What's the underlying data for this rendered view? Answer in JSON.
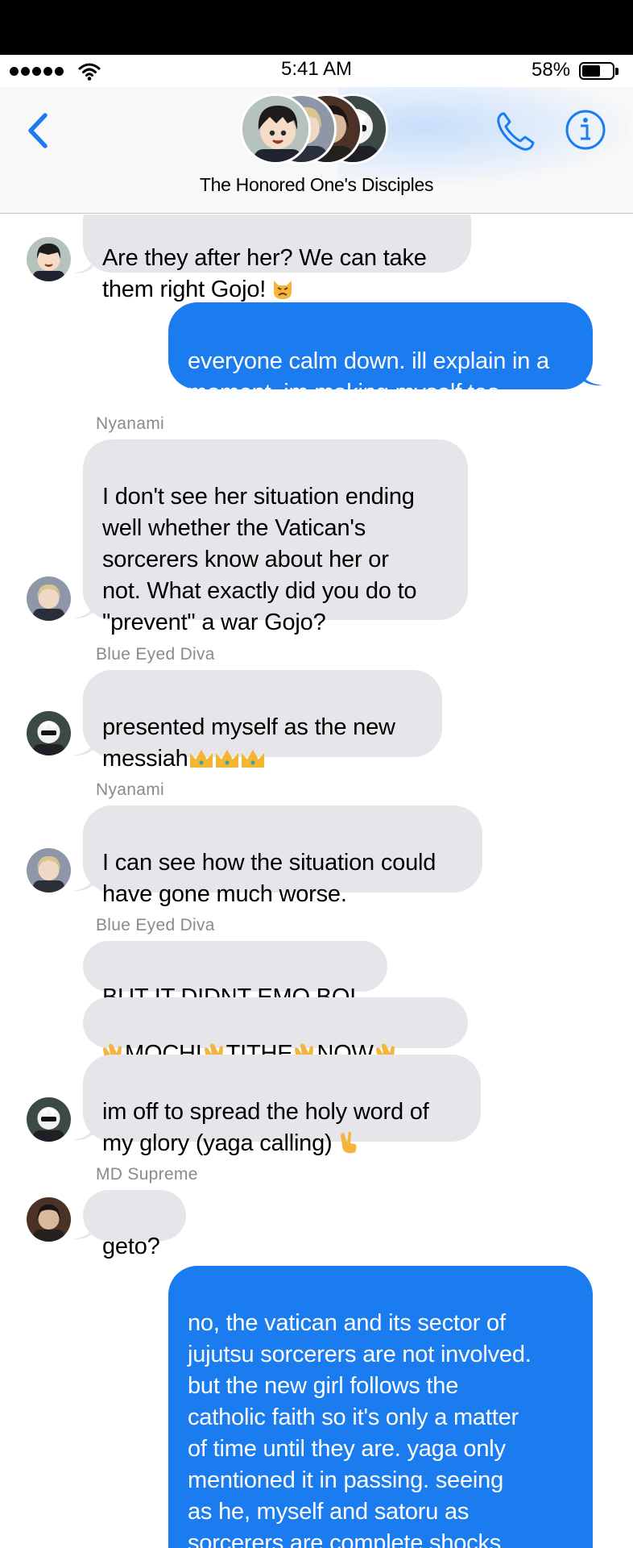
{
  "status_bar": {
    "time": "5:41 AM",
    "battery_percent": "58%",
    "battery_level": 0.58,
    "signal_bars": 5
  },
  "header": {
    "group_name": "The Honored One's Disciples",
    "back_icon": "chevron-left-icon",
    "call_icon": "phone-icon",
    "info_icon": "info-icon",
    "accent_color": "#1b7cf0"
  },
  "senders": {
    "nyanami": "Nyanami",
    "diva_1": "Blue Eyed Diva",
    "nyanami_2": "Nyanami",
    "diva_2": "Blue Eyed Diva",
    "md": "MD Supreme"
  },
  "messages": {
    "m1": "Are they after her? We can take\nthem right Gojo!",
    "m2": "everyone calm down. ill explain in a\nmoment. im making myself tea",
    "m3": "I don't see her situation ending\nwell whether the Vatican's\nsorcerers know about her or\nnot. What exactly did you do to\n\"prevent\" a war Gojo?",
    "m4": "presented myself as the new\nmessiah",
    "m5": "I can see how the situation could\nhave gone much worse.",
    "m6": "BUT IT DIDNT EMO BOI",
    "m7_1": "MOCHI",
    "m7_2": "TITHE",
    "m7_3": "NOW",
    "m8": "im off to spread the holy word of\nmy glory (yaga calling)",
    "m9": "geto?",
    "m10": "no, the vatican and its sector of\njujutsu sorcerers are not involved.\nbut the new girl follows the\ncatholic faith so it's only a matter\nof time until they are. yaga only\nmentioned it in passing. seeing\nas he, myself and satoru as\nsorcerers are complete shocks\nto her, he assumes she knows"
  },
  "emoji": {
    "m1": "pouting-cat-emoji",
    "m4": "crown-emoji",
    "m7": "clapping-hands-emoji",
    "m8": "victory-hand-emoji"
  },
  "colors": {
    "incoming_bubble": "#e5e5ea",
    "outgoing_bubble": "#1b7cf0",
    "sender_label": "#8a8a8e"
  }
}
